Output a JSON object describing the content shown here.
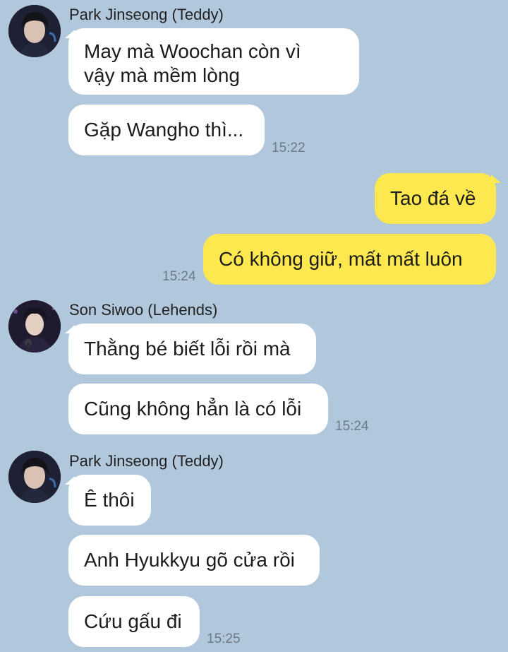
{
  "groups": [
    {
      "sender": "Park Jinseong (Teddy)",
      "avatar": "avatar-teddy",
      "messages": [
        {
          "text": "May mà Woochan còn vì\nvậy mà mềm lòng"
        },
        {
          "text": "Gặp Wangho thì...",
          "time": "15:22"
        }
      ]
    },
    {
      "sender": "me",
      "messages": [
        {
          "text": "Tao đá về"
        },
        {
          "text": "Có không giữ, mất mất luôn",
          "time": "15:24"
        }
      ]
    },
    {
      "sender": "Son Siwoo (Lehends)",
      "avatar": "avatar-lehends",
      "messages": [
        {
          "text": "Thằng bé biết lỗi rồi mà"
        },
        {
          "text": "Cũng không hẳn là có lỗi",
          "time": "15:24"
        }
      ]
    },
    {
      "sender": "Park Jinseong (Teddy)",
      "avatar": "avatar-teddy",
      "messages": [
        {
          "text": "Ê thôi"
        },
        {
          "text": "Anh Hyukkyu gõ cửa rồi"
        },
        {
          "text": "Cứu gấu đi",
          "time": "15:25"
        }
      ]
    }
  ]
}
